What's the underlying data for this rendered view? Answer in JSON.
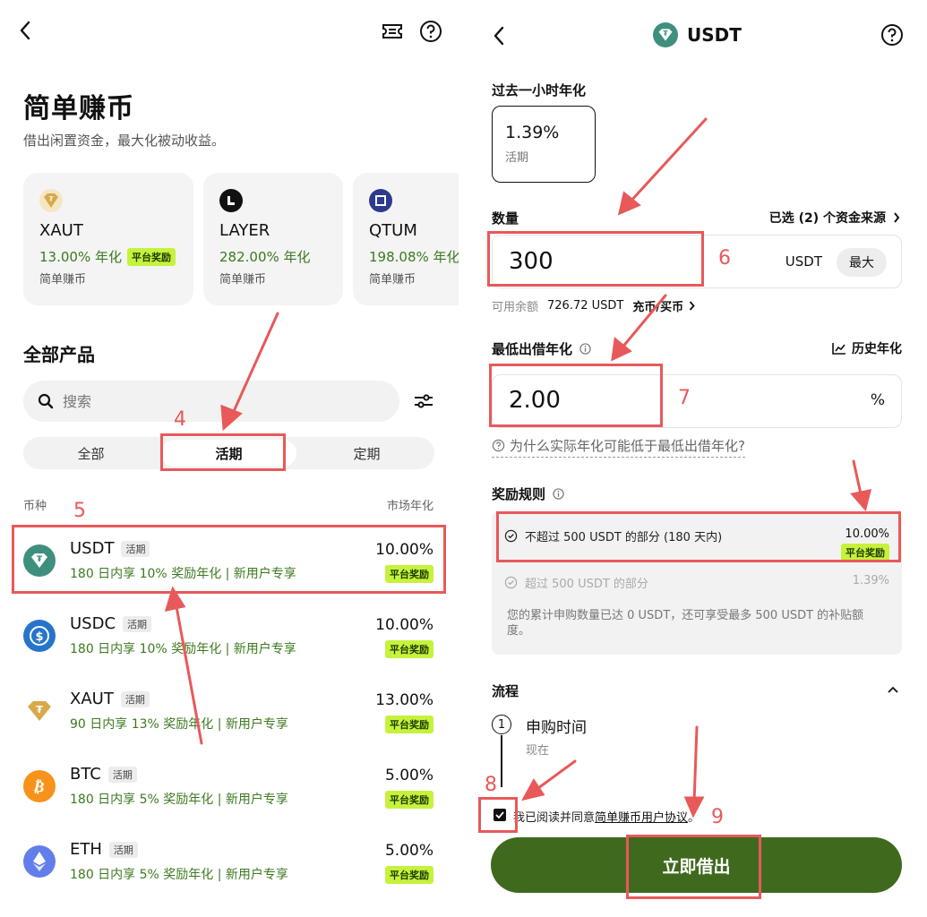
{
  "left": {
    "title": "简单赚币",
    "subtitle": "借出闲置资金，最大化被动收益。",
    "featured": [
      {
        "name": "XAUT",
        "apy": "13.00% 年化",
        "badge": "平台奖励",
        "sub": "简单赚币"
      },
      {
        "name": "LAYER",
        "apy": "282.00% 年化",
        "sub": "简单赚币"
      },
      {
        "name": "QTUM",
        "apy": "198.08% 年化",
        "sub": "简单赚币"
      }
    ],
    "all_products": "全部产品",
    "search_placeholder": "搜索",
    "segments": [
      "全部",
      "活期",
      "定期"
    ],
    "col_coin": "币种",
    "col_rate": "市场年化",
    "products": [
      {
        "name": "USDT",
        "tag": "活期",
        "desc": "180 日内享 10% 奖励年化 | 新用户专享",
        "rate": "10.00%",
        "badge": "平台奖励"
      },
      {
        "name": "USDC",
        "tag": "活期",
        "desc": "180 日内享 10% 奖励年化 | 新用户专享",
        "rate": "10.00%",
        "badge": "平台奖励"
      },
      {
        "name": "XAUT",
        "tag": "活期",
        "desc": "90 日内享 13% 奖励年化 | 新用户专享",
        "rate": "13.00%",
        "badge": "平台奖励"
      },
      {
        "name": "BTC",
        "tag": "活期",
        "desc": "180 日内享 5% 奖励年化 | 新用户专享",
        "rate": "5.00%",
        "badge": "平台奖励"
      },
      {
        "name": "ETH",
        "tag": "活期",
        "desc": "180 日内享 5% 奖励年化 | 新用户专享",
        "rate": "5.00%",
        "badge": "平台奖励"
      }
    ]
  },
  "right": {
    "title": "USDT",
    "past_hour_label": "过去一小时年化",
    "past_hour_rate": "1.39%",
    "past_hour_type": "活期",
    "amount_label": "数量",
    "sources": "已选 (2) 个资金来源",
    "amount_value": "300",
    "amount_unit": "USDT",
    "max_label": "最大",
    "balance_label": "可用余额",
    "balance_value": "726.72 USDT",
    "deposit_link": "充币/买币",
    "min_rate_label": "最低出借年化",
    "history_label": "历史年化",
    "min_rate_value": "2.00",
    "min_rate_unit": "%",
    "why_link": "为什么实际年化可能低于最低出借年化?",
    "reward_label": "奖励规则",
    "rule1": "不超过 500 USDT 的部分 (180 天内)",
    "rule1_rate": "10.00%",
    "rule1_badge": "平台奖励",
    "rule2": "超过 500 USDT 的部分",
    "rule2_rate": "1.39%",
    "rule_note": "您的累计申购数量已达 0 USDT，还可享受最多 500 USDT 的补贴额度。",
    "process_label": "流程",
    "step1_num": "1",
    "step1_title": "申购时间",
    "step1_sub": "现在",
    "agree_prefix": "我已阅读并同意",
    "agree_link": "简单赚币用户协议",
    "agree_suffix": "。",
    "submit": "立即借出"
  },
  "annotations": [
    "4",
    "5",
    "6",
    "7",
    "8",
    "9"
  ],
  "colors": {
    "accent_green": "#3f6a1e",
    "badge_lime": "#c6f23c",
    "annotation_red": "#e8595a",
    "positive_text": "#3c7a1f"
  }
}
